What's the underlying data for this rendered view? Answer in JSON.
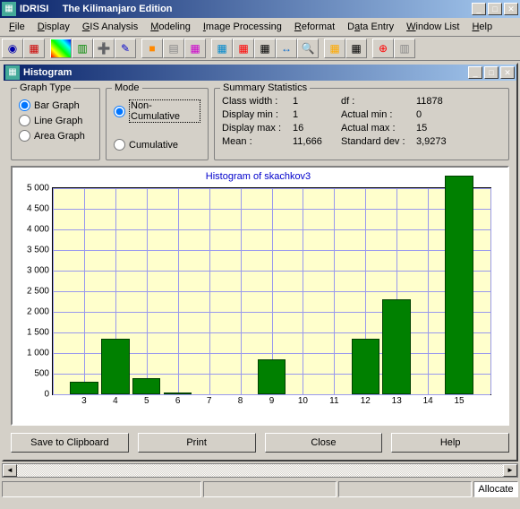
{
  "app": {
    "name": "IDRISI",
    "edition": "The Kilimanjaro Edition"
  },
  "menus": {
    "file": "File",
    "display": "Display",
    "gis": "GIS Analysis",
    "modeling": "Modeling",
    "image": "Image Processing",
    "reformat": "Reformat",
    "data": "Data Entry",
    "window": "Window List",
    "help": "Help"
  },
  "child": {
    "title": "Histogram"
  },
  "groups": {
    "graph": "Graph Type",
    "mode": "Mode",
    "stats": "Summary Statistics"
  },
  "graph_types": {
    "bar": "Bar Graph",
    "line": "Line Graph",
    "area": "Area Graph"
  },
  "modes": {
    "noncum": "Non-Cumulative",
    "cum": "Cumulative"
  },
  "stats": {
    "class_width_l": "Class width :",
    "class_width_v": "1",
    "df_l": "df :",
    "df_v": "11878",
    "disp_min_l": "Display min :",
    "disp_min_v": "1",
    "act_min_l": "Actual min :",
    "act_min_v": "0",
    "disp_max_l": "Display max :",
    "disp_max_v": "16",
    "act_max_l": "Actual max :",
    "act_max_v": "15",
    "mean_l": "Mean :",
    "mean_v": "11,666",
    "std_l": "Standard dev :",
    "std_v": "3,9273"
  },
  "chart_data": {
    "type": "bar",
    "title": "Histogram of skachkov3",
    "categories": [
      3,
      4,
      5,
      6,
      7,
      8,
      9,
      10,
      11,
      12,
      13,
      14,
      15
    ],
    "values": [
      300,
      1350,
      400,
      50,
      0,
      0,
      850,
      0,
      0,
      1350,
      2300,
      0,
      5300
    ],
    "xlabel": "",
    "ylabel": "",
    "ylim": [
      0,
      5000
    ],
    "yticks": [
      0,
      500,
      1000,
      1500,
      2000,
      2500,
      3000,
      3500,
      4000,
      4500,
      5000
    ],
    "ytick_labels": [
      "0",
      "500",
      "1 000",
      "1 500",
      "2 000",
      "2 500",
      "3 000",
      "3 500",
      "4 000",
      "4 500",
      "5 000"
    ]
  },
  "buttons": {
    "save": "Save to Clipboard",
    "print": "Print",
    "close": "Close",
    "help": "Help"
  },
  "status": {
    "allocate": "Allocate"
  }
}
